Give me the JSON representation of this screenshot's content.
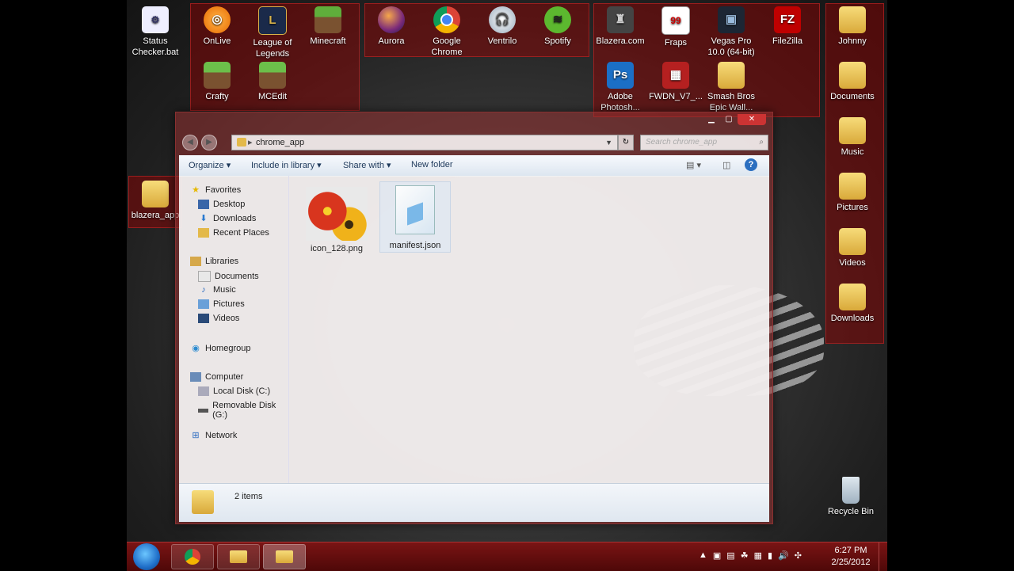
{
  "desktop": {
    "loose_icons": [
      {
        "name": "status-checker-bat",
        "label": "Status Checker.bat"
      },
      {
        "name": "blazera-app-folder",
        "label": "blazera_app"
      }
    ],
    "fence1": [
      {
        "label": "OnLive"
      },
      {
        "label": "League of Legends"
      },
      {
        "label": "Minecraft"
      },
      {
        "label": "Crafty"
      },
      {
        "label": "MCEdit"
      }
    ],
    "fence2": [
      {
        "label": "Aurora"
      },
      {
        "label": "Google Chrome"
      },
      {
        "label": "Ventrilo"
      },
      {
        "label": "Spotify"
      }
    ],
    "fence3": [
      {
        "label": "Blazera.com"
      },
      {
        "label": "Fraps"
      },
      {
        "label": "Vegas Pro 10.0 (64-bit)"
      },
      {
        "label": "FileZilla"
      },
      {
        "label": "Adobe Photosh..."
      },
      {
        "label": "FWDN_V7_..."
      },
      {
        "label": "Smash Bros Epic Wall..."
      }
    ],
    "fence4": [
      {
        "label": "Johnny"
      },
      {
        "label": "Documents"
      },
      {
        "label": "Music"
      },
      {
        "label": "Pictures"
      },
      {
        "label": "Videos"
      },
      {
        "label": "Downloads"
      }
    ],
    "recycle_bin": "Recycle Bin",
    "drag_ghost": "chrome_app"
  },
  "window": {
    "address": "chrome_app",
    "search_placeholder": "Search chrome_app",
    "toolbar": {
      "organize": "Organize",
      "include": "Include in library",
      "share": "Share with",
      "new_folder": "New folder"
    },
    "nav": {
      "favorites": "Favorites",
      "desktop": "Desktop",
      "downloads": "Downloads",
      "recent": "Recent Places",
      "libraries": "Libraries",
      "documents": "Documents",
      "music": "Music",
      "pictures": "Pictures",
      "videos": "Videos",
      "homegroup": "Homegroup",
      "computer": "Computer",
      "local_disk": "Local Disk (C:)",
      "removable": "Removable Disk (G:)",
      "network": "Network"
    },
    "files": [
      {
        "name": "icon_128.png"
      },
      {
        "name": "manifest.json"
      }
    ],
    "status": "2 items"
  },
  "taskbar": {
    "time": "6:27 PM",
    "date": "2/25/2012"
  },
  "colors": {
    "fence": "#960000",
    "taskbar": "#6a1010",
    "chrome_red": "#db4437"
  }
}
